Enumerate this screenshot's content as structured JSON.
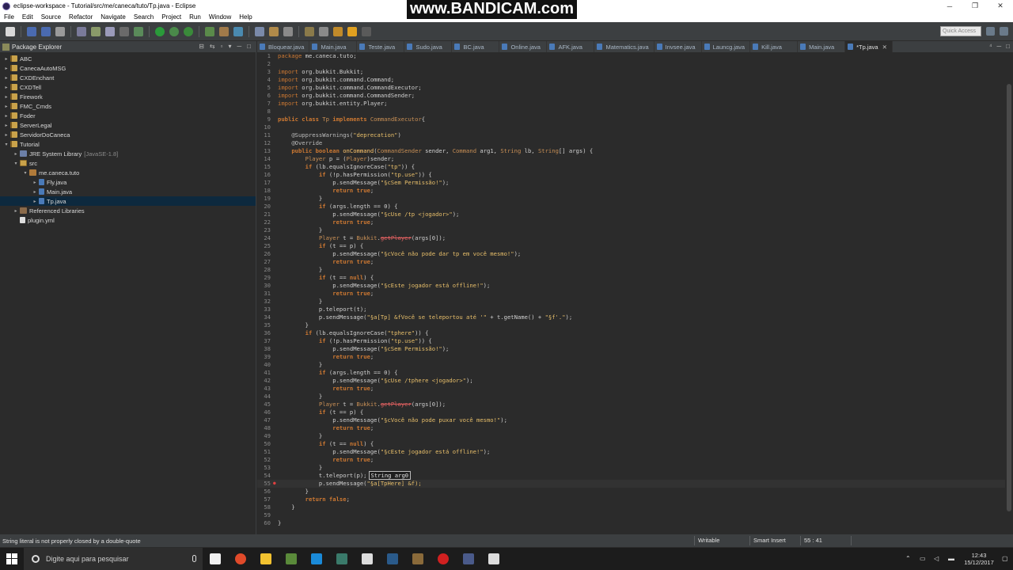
{
  "window": {
    "title": "eclipse-workspace - Tutorial/src/me/caneca/tuto/Tp.java - Eclipse",
    "watermark": "www.BANDICAM.com"
  },
  "menu": [
    "File",
    "Edit",
    "Source",
    "Refactor",
    "Navigate",
    "Search",
    "Project",
    "Run",
    "Window",
    "Help"
  ],
  "toolbar": {
    "quick_access": "Quick Access"
  },
  "explorer": {
    "title": "Package Explorer",
    "items": [
      {
        "label": "ABC",
        "depth": 0,
        "icon": "proj",
        "arrow": "▸"
      },
      {
        "label": "CanecaAutoMSG",
        "depth": 0,
        "icon": "proj",
        "arrow": "▸"
      },
      {
        "label": "CXDEnchant",
        "depth": 0,
        "icon": "proj",
        "arrow": "▸"
      },
      {
        "label": "CXDTell",
        "depth": 0,
        "icon": "proj",
        "arrow": "▸"
      },
      {
        "label": "Firework",
        "depth": 0,
        "icon": "proj",
        "arrow": "▸"
      },
      {
        "label": "FMC_Cmds",
        "depth": 0,
        "icon": "proj",
        "arrow": "▸"
      },
      {
        "label": "Foder",
        "depth": 0,
        "icon": "proj",
        "arrow": "▸"
      },
      {
        "label": "ServerLegal",
        "depth": 0,
        "icon": "proj",
        "arrow": "▸"
      },
      {
        "label": "ServidorDoCaneca",
        "depth": 0,
        "icon": "proj",
        "arrow": "▸"
      },
      {
        "label": "Tutorial",
        "depth": 0,
        "icon": "proj",
        "arrow": "▾"
      },
      {
        "label": "JRE System Library",
        "extra": "[JavaSE-1.8]",
        "depth": 1,
        "icon": "jre",
        "arrow": "▸"
      },
      {
        "label": "src",
        "depth": 1,
        "icon": "src",
        "arrow": "▾"
      },
      {
        "label": "me.caneca.tuto",
        "depth": 2,
        "icon": "pkg",
        "arrow": "▾"
      },
      {
        "label": "Fly.java",
        "depth": 3,
        "icon": "java",
        "arrow": "▸"
      },
      {
        "label": "Main.java",
        "depth": 3,
        "icon": "java",
        "arrow": "▸"
      },
      {
        "label": "Tp.java",
        "depth": 3,
        "icon": "java",
        "arrow": "▸",
        "selected": true
      },
      {
        "label": "Referenced Libraries",
        "depth": 1,
        "icon": "lib",
        "arrow": "▸"
      },
      {
        "label": "plugin.yml",
        "depth": 1,
        "icon": "yml",
        "arrow": ""
      }
    ]
  },
  "tabs": [
    {
      "label": "Bloquear.java"
    },
    {
      "label": "Main.java"
    },
    {
      "label": "Teste.java"
    },
    {
      "label": "Sudo.java"
    },
    {
      "label": "BC.java"
    },
    {
      "label": "Online.java"
    },
    {
      "label": "AFK.java"
    },
    {
      "label": "Matematics.java"
    },
    {
      "label": "Invsee.java"
    },
    {
      "label": "Launcg.java"
    },
    {
      "label": "Kill.java"
    },
    {
      "label": "Main.java"
    },
    {
      "label": "*Tp.java",
      "active": true
    }
  ],
  "tabs_overflow": "⁴",
  "code": [
    "[[kwp|package]] me.caneca.tuto;",
    "",
    "[[kwp|import]] org.bukkit.Bukkit;",
    "[[kwp|import]] org.bukkit.command.Command;",
    "[[kwp|import]] org.bukkit.command.CommandExecutor;",
    "[[kwp|import]] org.bukkit.command.CommandSender;",
    "[[kwp|import]] org.bukkit.entity.Player;",
    "",
    "[[kw|public]] [[kw|class]] [[typ|Tp]] [[kw|implements]] [[typ|CommandExecutor]]{",
    "",
    "    [[ann|@SuppressWarnings]]([[str|\"deprecation\"]])",
    "    [[ann|@Override]]",
    "    [[kw|public]] [[kw|boolean]] [[mth|onCommand]]([[typ|CommandSender]] sender, [[typ|Command]] arg1, [[typ|String]] lb, [[typ|String]][] args) {",
    "        [[typ|Player]] p = ([[typ|Player]])sender;",
    "        [[kw|if]] (lb.equalsIgnoreCase([[str|\"tp\"]])) {",
    "            [[kw|if]] (!p.hasPermission([[str|\"tp.use\"]])) {",
    "                p.sendMessage([[str|\"§cSem Permissão!\"]]);",
    "                [[kw|return]] [[kw|true]];",
    "            }",
    "            [[kw|if]] (args.length == 0) {",
    "                p.sendMessage([[str|\"§cUse /tp <jogador>\"]]);",
    "                [[kw|return]] [[kw|true]];",
    "            }",
    "            [[typ|Player]] t = [[typ|Bukkit]].[[bad|getPlayer]](args[0]);",
    "            [[kw|if]] (t == p) {",
    "                p.sendMessage([[str|\"§cVocê não pode dar tp em você mesmo!\"]]);",
    "                [[kw|return]] [[kw|true]];",
    "            }",
    "            [[kw|if]] (t == [[kw|null]]) {",
    "                p.sendMessage([[str|\"§cEste jogador está offline!\"]]);",
    "                [[kw|return]] [[kw|true]];",
    "            }",
    "            p.teleport(t);",
    "            p.sendMessage([[str|\"§a[Tp] &fVocê se teleportou até '\"]] + t.getName() + [[str|\"§f'.\"]]);",
    "        }",
    "        [[kw|if]] (lb.equalsIgnoreCase([[str|\"tphere\"]])) {",
    "            [[kw|if]] (!p.hasPermission([[str|\"tp.use\"]])) {",
    "                p.sendMessage([[str|\"§cSem Permissão!\"]]);",
    "                [[kw|return]] [[kw|true]];",
    "            }",
    "            [[kw|if]] (args.length == 0) {",
    "                p.sendMessage([[str|\"§cUse /tphere <jogador>\"]]);",
    "                [[kw|return]] [[kw|true]];",
    "            }",
    "            [[typ|Player]] t = [[typ|Bukkit]].[[bad|getPlayer]](args[0]);",
    "            [[kw|if]] (t == p) {",
    "                p.sendMessage([[str|\"§cVocê não pode puxar você mesmo!\"]]);",
    "                [[kw|return]] [[kw|true]];",
    "            }",
    "            [[kw|if]] (t == [[kw|null]]) {",
    "                p.sendMessage([[str|\"§cEste jogador está offline!\"]]);",
    "                [[kw|return]] [[kw|true]];",
    "            }",
    "            t.teleport(p);[[hint|String arg0]]",
    "            p.sendMessage([[str|\"§a[TpHere] &f);]]",
    "        }",
    "        [[kw|return]] [[kw|false]];",
    "    }",
    "",
    "}"
  ],
  "code_line_numbers": [
    "1",
    "2",
    "3",
    "4",
    "5",
    "6",
    "7",
    "8",
    "9",
    "10",
    "11",
    "12",
    "13",
    "14",
    "15",
    "16",
    "17",
    "18",
    "19",
    "20",
    "21",
    "22",
    "23",
    "24",
    "25",
    "26",
    "27",
    "28",
    "29",
    "30",
    "31",
    "32",
    "33",
    "34",
    "35",
    "36",
    "37",
    "38",
    "39",
    "40",
    "41",
    "42",
    "43",
    "44",
    "45",
    "46",
    "47",
    "48",
    "49",
    "50",
    "51",
    "52",
    "53",
    "54",
    "55",
    "56",
    "57",
    "58",
    "59",
    "60"
  ],
  "error_line": 55,
  "status": {
    "message": "String literal is not properly closed by a double-quote",
    "mode": "Writable",
    "insert": "Smart Insert",
    "position": "55 : 41"
  },
  "taskbar": {
    "search_placeholder": "Digite aqui para pesquisar",
    "time": "12:43",
    "date": "15/12/2017",
    "apps": [
      "#f0f0f0",
      "#e04a2a",
      "#f2c230",
      "#5a8a3a",
      "#1a8ad8",
      "#3a7a6a",
      "#dddddd",
      "#2a5a8a",
      "#8a6a3a",
      "#d02020",
      "#4a5a8a",
      "#dddddd"
    ]
  },
  "colors": {
    "accent": "#0d293e",
    "background": "#2b2b2b",
    "panel": "#3c3f41"
  }
}
